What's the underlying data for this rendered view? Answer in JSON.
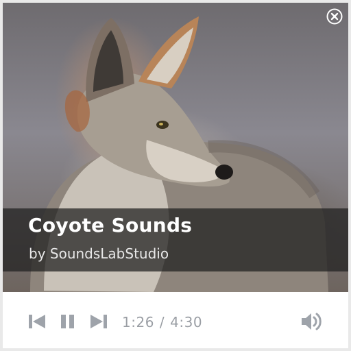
{
  "player": {
    "title": "Coyote Sounds",
    "artist": "by SoundsLabStudio",
    "current_time": "1:26",
    "separator": "/",
    "duration": "4:30",
    "state": "playing"
  },
  "controls": {
    "icons": [
      "close-icon",
      "skip-previous-icon",
      "pause-icon",
      "skip-next-icon",
      "volume-icon"
    ]
  },
  "colors": {
    "controls": "#9ea3aa",
    "title_band": "#1e1e1e",
    "title_text": "#ffffff"
  }
}
